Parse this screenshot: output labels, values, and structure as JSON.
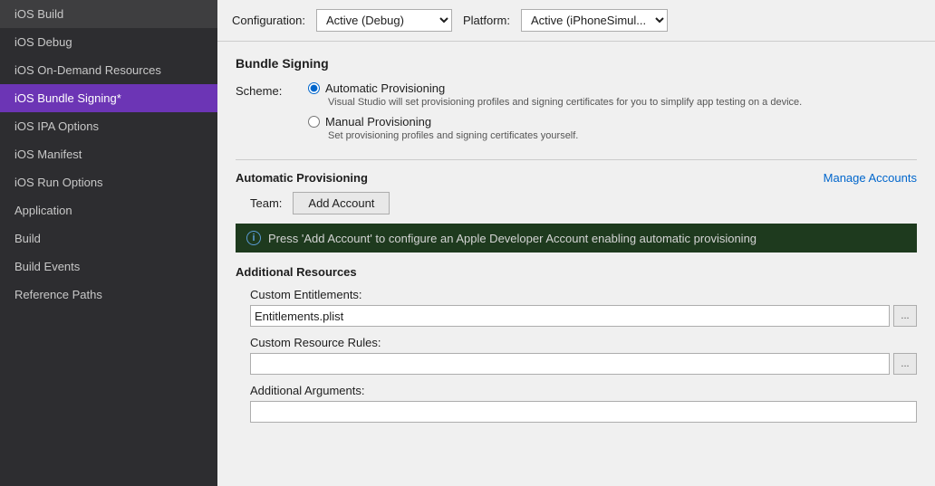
{
  "sidebar": {
    "items": [
      {
        "label": "iOS Build",
        "active": false
      },
      {
        "label": "iOS Debug",
        "active": false
      },
      {
        "label": "iOS On-Demand Resources",
        "active": false
      },
      {
        "label": "iOS Bundle Signing*",
        "active": true
      },
      {
        "label": "iOS IPA Options",
        "active": false
      },
      {
        "label": "iOS Manifest",
        "active": false
      },
      {
        "label": "iOS Run Options",
        "active": false
      },
      {
        "label": "Application",
        "active": false
      },
      {
        "label": "Build",
        "active": false
      },
      {
        "label": "Build Events",
        "active": false
      },
      {
        "label": "Reference Paths",
        "active": false
      }
    ]
  },
  "toolbar": {
    "configuration_label": "Configuration:",
    "configuration_value": "Active (Debug)",
    "platform_label": "Platform:",
    "platform_value": "Active (iPhoneSimul..."
  },
  "bundle_signing": {
    "section_title": "Bundle Signing",
    "scheme_label": "Scheme:",
    "automatic_label": "Automatic Provisioning",
    "automatic_desc": "Visual Studio will set provisioning profiles and signing certificates for you to simplify app testing on a device.",
    "manual_label": "Manual Provisioning",
    "manual_desc": "Set provisioning profiles and signing certificates yourself.",
    "auto_prov_title": "Automatic Provisioning",
    "manage_accounts_label": "Manage Accounts",
    "team_label": "Team:",
    "add_account_label": "Add Account",
    "info_message": "Press 'Add Account' to configure an Apple Developer Account enabling automatic provisioning"
  },
  "additional_resources": {
    "section_title": "Additional Resources",
    "custom_entitlements_label": "Custom Entitlements:",
    "custom_entitlements_value": "Entitlements.plist",
    "custom_resource_rules_label": "Custom Resource Rules:",
    "custom_resource_rules_value": "",
    "additional_arguments_label": "Additional Arguments:",
    "additional_arguments_value": "",
    "browse_label": "..."
  }
}
